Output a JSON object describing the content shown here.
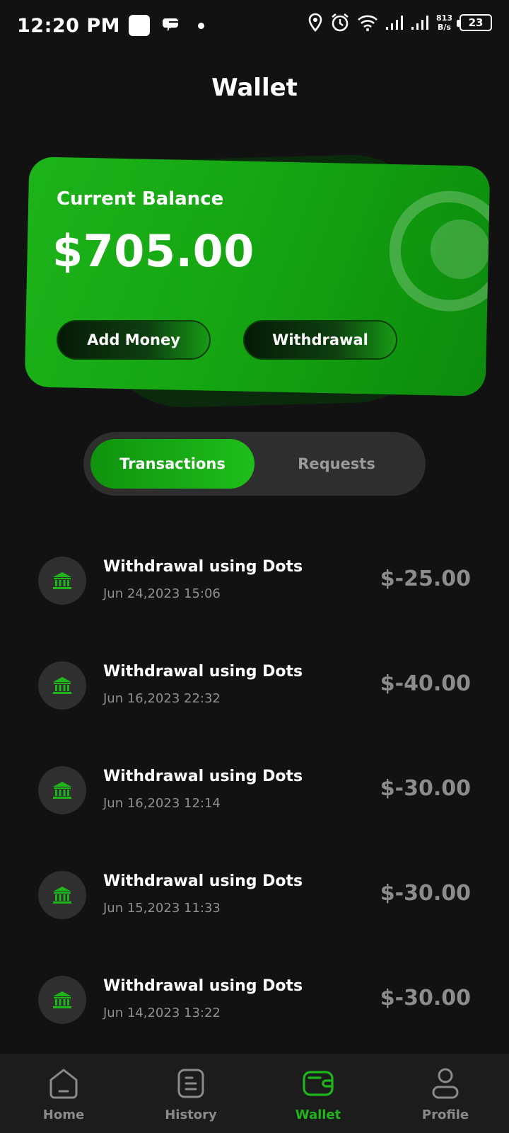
{
  "status_bar": {
    "time": "12:20 PM",
    "net_speed_value": "813",
    "net_speed_unit": "B/s",
    "battery": "23",
    "icons": [
      "square-app-icon",
      "chat-bubble-icon",
      "notification-dot-icon",
      "location-icon",
      "alarm-icon",
      "wifi-icon",
      "signal-icon",
      "signal-icon",
      "battery-icon"
    ]
  },
  "header": {
    "title": "Wallet"
  },
  "balance_card": {
    "label": "Current Balance",
    "amount": "$705.00",
    "add_money_label": "Add Money",
    "withdrawal_label": "Withdrawal"
  },
  "tabs": {
    "items": [
      {
        "label": "Transactions",
        "active": true
      },
      {
        "label": "Requests",
        "active": false
      }
    ]
  },
  "transactions": [
    {
      "title": "Withdrawal using Dots",
      "date": "Jun 24,2023 15:06",
      "amount": "$-25.00",
      "icon": "bank-icon"
    },
    {
      "title": "Withdrawal using Dots",
      "date": "Jun 16,2023 22:32",
      "amount": "$-40.00",
      "icon": "bank-icon"
    },
    {
      "title": "Withdrawal using Dots",
      "date": "Jun 16,2023 12:14",
      "amount": "$-30.00",
      "icon": "bank-icon"
    },
    {
      "title": "Withdrawal using Dots",
      "date": "Jun 15,2023 11:33",
      "amount": "$-30.00",
      "icon": "bank-icon"
    },
    {
      "title": "Withdrawal using Dots",
      "date": "Jun 14,2023 13:22",
      "amount": "$-30.00",
      "icon": "bank-icon"
    }
  ],
  "bottom_nav": {
    "items": [
      {
        "label": "Home",
        "icon": "home-icon",
        "active": false
      },
      {
        "label": "History",
        "icon": "history-icon",
        "active": false
      },
      {
        "label": "Wallet",
        "icon": "wallet-icon",
        "active": true
      },
      {
        "label": "Profile",
        "icon": "profile-icon",
        "active": false
      }
    ]
  },
  "colors": {
    "background": "#121212",
    "accent_green": "#1fb61b",
    "muted_text": "#8f8f8f",
    "surface": "#2e2e2e"
  }
}
